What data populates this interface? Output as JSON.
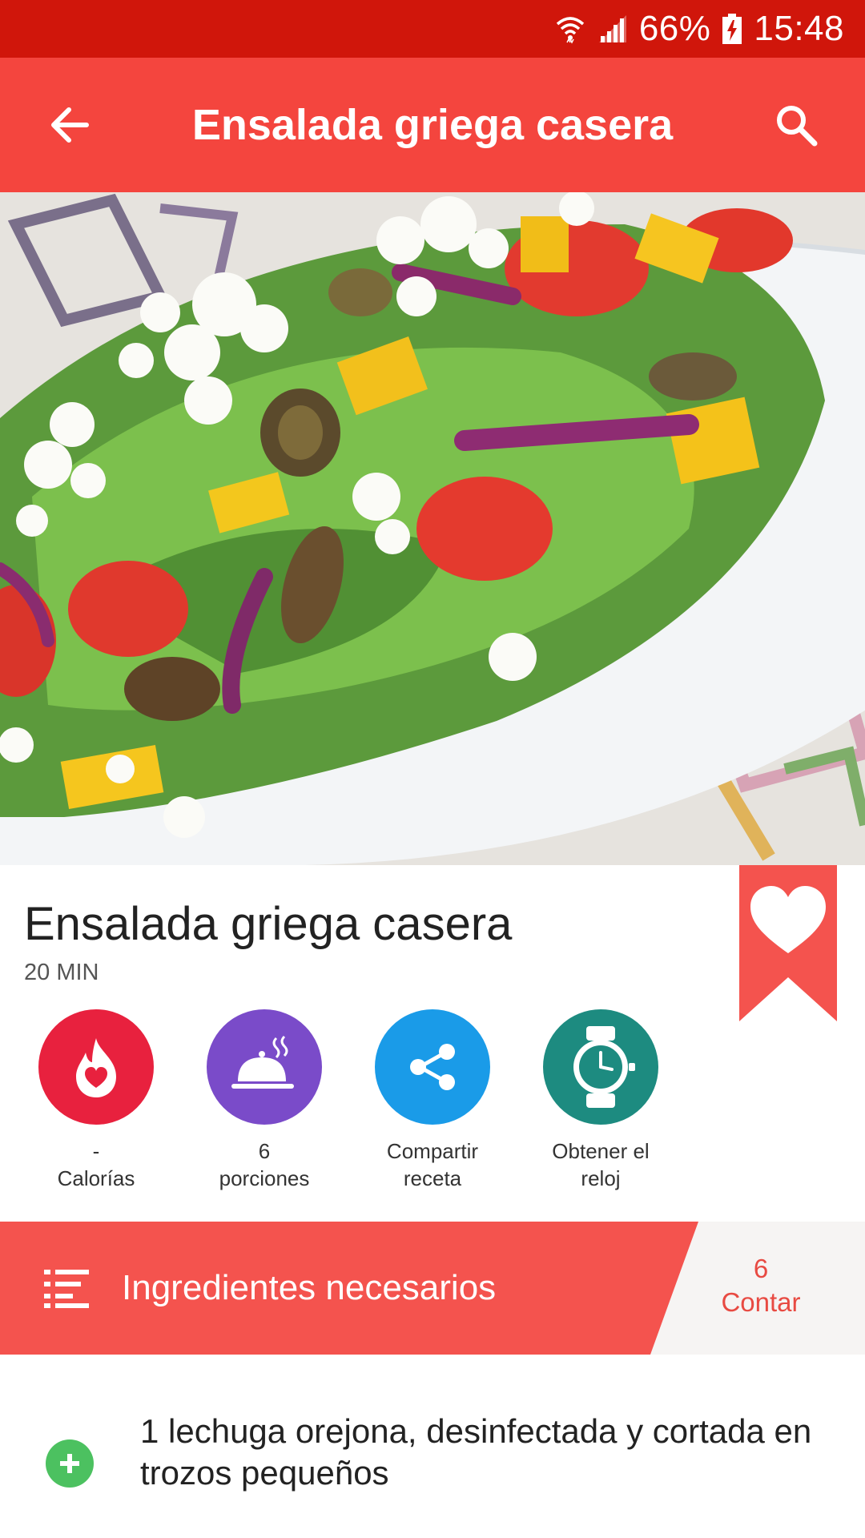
{
  "status_bar": {
    "battery_percent": "66%",
    "time": "15:48",
    "icons": [
      "wifi-icon",
      "signal-icon",
      "battery-charging-icon"
    ]
  },
  "app_bar": {
    "title": "Ensalada griega casera",
    "back_icon": "arrow-left-icon",
    "search_icon": "search-icon"
  },
  "recipe": {
    "title": "Ensalada griega casera",
    "time": "20 MIN"
  },
  "actions": [
    {
      "value": "-",
      "label": "Calorías",
      "icon": "flame-heart-icon",
      "color": "#e8213e"
    },
    {
      "value": "6",
      "label": "porciones",
      "icon": "serving-dish-icon",
      "color": "#7a4bc9"
    },
    {
      "value": "Compartir",
      "label": "receta",
      "icon": "share-icon",
      "color": "#1a9be8"
    },
    {
      "value": "Obtener el",
      "label": "reloj",
      "icon": "watch-icon",
      "color": "#1d8b80"
    }
  ],
  "ingredients": {
    "title": "Ingredientes necesarios",
    "count": "6",
    "count_label": "Contar",
    "items": [
      {
        "text": "1 lechuga orejona, desinfectada y cortada en trozos pequeños"
      }
    ]
  },
  "colors": {
    "status_bar": "#d0160b",
    "app_bar": "#f4453e",
    "accent": "#f4534e",
    "add_button": "#4cc160"
  }
}
